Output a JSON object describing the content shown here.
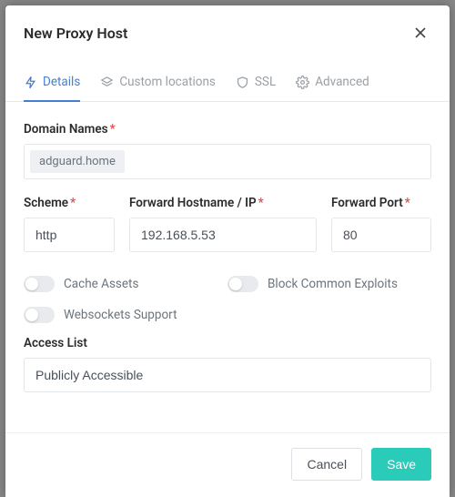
{
  "modal": {
    "title": "New Proxy Host"
  },
  "tabs": {
    "details": "Details",
    "custom_locations": "Custom locations",
    "ssl": "SSL",
    "advanced": "Advanced"
  },
  "labels": {
    "domain_names": "Domain Names",
    "scheme": "Scheme",
    "forward_host": "Forward Hostname / IP",
    "forward_port": "Forward Port",
    "access_list": "Access List"
  },
  "form": {
    "domain_tag": "adguard.home",
    "scheme": "http",
    "forward_host": "192.168.5.53",
    "forward_port": "80",
    "access_list": "Publicly Accessible"
  },
  "toggles": {
    "cache_assets": "Cache Assets",
    "block_exploits": "Block Common Exploits",
    "websockets": "Websockets Support"
  },
  "footer": {
    "cancel": "Cancel",
    "save": "Save"
  }
}
